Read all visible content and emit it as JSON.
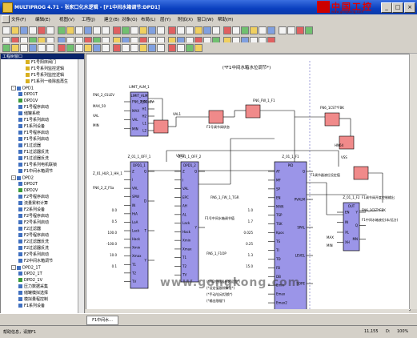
{
  "window": {
    "title": "MULTIPROG 4.71 - 张家口化水逻辑 - [F1中间水箱调节:DPD1]",
    "min": "_",
    "max": "□",
    "close": "×"
  },
  "logo": {
    "text": "中国工控",
    "url": "www.gongkong.com"
  },
  "menu": [
    "文件(F)",
    "编辑(E)",
    "视图(V)",
    "工程(J)",
    "建立(B)",
    "对象(O)",
    "布局(L)",
    "层(Y)",
    "附加(X)",
    "窗口(W)",
    "帮助(H)"
  ],
  "tree": {
    "header": "工程树窗口",
    "rows": [
      {
        "t": "F1号阳床阀门",
        "lvl": 3,
        "ico": "y"
      },
      {
        "t": "F1号系列监控逻辑",
        "lvl": 3,
        "ico": "y"
      },
      {
        "t": "F1号系列监控逻辑",
        "lvl": 3,
        "ico": "y"
      },
      {
        "t": "F1系列一级除盐再生",
        "lvl": 3,
        "ico": "y"
      },
      {
        "t": "DPD1",
        "lvl": 1,
        "ico": "b",
        "exp": "-"
      },
      {
        "t": "DPD1T",
        "lvl": 2,
        "ico": "b"
      },
      {
        "t": "DPD1V",
        "lvl": 2,
        "ico": "g"
      },
      {
        "t": "F1号程序启动",
        "lvl": 2,
        "ico": "b"
      },
      {
        "t": "储罐系统",
        "lvl": 2,
        "ico": "b"
      },
      {
        "t": "F1号系列启动",
        "lvl": 2,
        "ico": "b"
      },
      {
        "t": "F1系列设备",
        "lvl": 2,
        "ico": "b"
      },
      {
        "t": "F1号程序启动",
        "lvl": 2,
        "ico": "b"
      },
      {
        "t": "F1号系列启动",
        "lvl": 2,
        "ico": "b"
      },
      {
        "t": "F1过滤器",
        "lvl": 2,
        "ico": "b"
      },
      {
        "t": "F1过滤器反洗",
        "lvl": 2,
        "ico": "b"
      },
      {
        "t": "F1过滤器反洗",
        "lvl": 2,
        "ico": "b"
      },
      {
        "t": "F1号系列电机联锁",
        "lvl": 2,
        "ico": "b"
      },
      {
        "t": "F1中间水箱调节",
        "lvl": 2,
        "ico": "b"
      },
      {
        "t": "DPD2",
        "lvl": 1,
        "ico": "b",
        "exp": "-"
      },
      {
        "t": "DPD2T",
        "lvl": 2,
        "ico": "b"
      },
      {
        "t": "DPD2V",
        "lvl": 2,
        "ico": "g"
      },
      {
        "t": "F2号程序启动",
        "lvl": 2,
        "ico": "b"
      },
      {
        "t": "流量累积计算",
        "lvl": 2,
        "ico": "b"
      },
      {
        "t": "F2系列设备",
        "lvl": 2,
        "ico": "b"
      },
      {
        "t": "F2号程序启动",
        "lvl": 2,
        "ico": "b"
      },
      {
        "t": "F2号系列启动",
        "lvl": 2,
        "ico": "b"
      },
      {
        "t": "F2过滤器",
        "lvl": 2,
        "ico": "b"
      },
      {
        "t": "F2号程序启动",
        "lvl": 2,
        "ico": "b"
      },
      {
        "t": "F2过滤器反洗",
        "lvl": 2,
        "ico": "b"
      },
      {
        "t": "F2过滤器反洗",
        "lvl": 2,
        "ico": "b"
      },
      {
        "t": "F2号系列启动",
        "lvl": 2,
        "ico": "b"
      },
      {
        "t": "F2中间水箱调节",
        "lvl": 2,
        "ico": "b"
      },
      {
        "t": "DPD2_1T",
        "lvl": 1,
        "ico": "b",
        "exp": "-"
      },
      {
        "t": "DPD2_1T",
        "lvl": 2,
        "ico": "b"
      },
      {
        "t": "DPD2_1V",
        "lvl": 2,
        "ico": "g"
      },
      {
        "t": "压力数据采集",
        "lvl": 2,
        "ico": "b"
      },
      {
        "t": "储罐模拟选择",
        "lvl": 2,
        "ico": "b"
      },
      {
        "t": "模拟量程控制",
        "lvl": 2,
        "ico": "b"
      },
      {
        "t": "F1系列设备",
        "lvl": 2,
        "ico": "b"
      }
    ]
  },
  "diagram": {
    "title": "(*F1中间水箱水位调节*)",
    "b1": {
      "inst": "LIMIT_ALM_1",
      "name": "LIMIT_ALM",
      "pins_in": [
        "FN6_2_01LEV",
        "MAX",
        "VAL",
        "MIN"
      ],
      "pins_out": [
        "MIN",
        "H1",
        "H2",
        "L1",
        "L2"
      ]
    },
    "b2": {
      "inst": "Z_01_1",
      "name": "DPD1_1_DP1",
      "pins_in": [
        "IN"
      ],
      "pins_out": [
        "Q"
      ]
    },
    "b3": {
      "inst": "Z_01_1_OFF_1",
      "name": "DPD1_1",
      "pins_in": [
        "Z",
        "I",
        "VAL",
        "SPW",
        "IN",
        "HiA",
        "LoA",
        "Lack",
        "Hack",
        "Xmin",
        "Xmax",
        "T1",
        "T2",
        "TV"
      ],
      "pins_out": [
        "Q",
        "D",
        "T",
        "Y"
      ]
    },
    "b4": {
      "inst": "Z_01_1_OFF_2",
      "name": "DPD1_2",
      "pins_in": [
        "Z",
        "I",
        "VAL",
        "EPC",
        "AH",
        "AL",
        "Lack",
        "Hack",
        "Xmin",
        "Xmax",
        "T1",
        "T2",
        "TV"
      ],
      "pins_out": [
        "Q",
        "Y"
      ]
    },
    "b5": {
      "inst": "Z_01_1_F1",
      "name": "PID",
      "pins_in": [
        "AT",
        "MF",
        "SP",
        "EN",
        "MAN",
        "TSP",
        "TSK",
        "Kpos",
        "TS",
        "TI",
        "TD",
        "FB",
        "DB",
        "Emin",
        "Emax",
        "Emax2"
      ],
      "pins_out": [
        "Q",
        "PVALM",
        "SPAL",
        "LEVEL",
        "SOPE"
      ]
    },
    "b6": {
      "inst": "Z_01_1_F2",
      "name": "OUT",
      "pins_in": [
        "EN",
        "IN",
        "XL",
        "XH"
      ],
      "pins_out": [
        "Y",
        "Q",
        "MN"
      ]
    },
    "labels": {
      "l1": "FN6_2_01LEV",
      "l2": "MAX_50",
      "l3": "VAL",
      "l4": "MIN",
      "l5": "VAL1",
      "l6": "VN62",
      "l7": "F1号调节阀状态",
      "l8": "FN6_FW_1_F1",
      "l9": "FN6_1CST*FBK",
      "l10": "HN64",
      "l11": "VSS",
      "l12": "FN6_1_FW_1_TGR",
      "l13": "Z_01_HLR_1_HH_1",
      "l14": "FN6_2_Z_FSa",
      "l15": "F1号中间水箱调节值",
      "l16": "F1调节器液位设定值",
      "l17": "F1中间水箱液位(本/远方)",
      "l18": "FN6_1CST*FBK",
      "l19": "F1调节阀开度控制输出",
      "l20": "MAX",
      "l21": "MIN",
      "l22": "FN6_1_F1OP"
    },
    "notes": [
      "(*PID控制器参数设置*)",
      "(*设定值跟踪算法*)",
      "(*手动/自动切换*)",
      "(*输出限幅*)"
    ],
    "consts": [
      "0.0",
      "0.5",
      "100.0",
      "-100.0",
      "10.0",
      "0.1",
      "1.0",
      "1.7",
      "0.025",
      "0.25",
      "1.3",
      "15.0"
    ]
  },
  "tab": {
    "label": "F1中间水..."
  },
  "status": {
    "help": "帮助信息，请按F1",
    "pos": "11,155",
    "zoom": "D:",
    "page": "100%"
  },
  "watermark": "www.gongkong.com"
}
